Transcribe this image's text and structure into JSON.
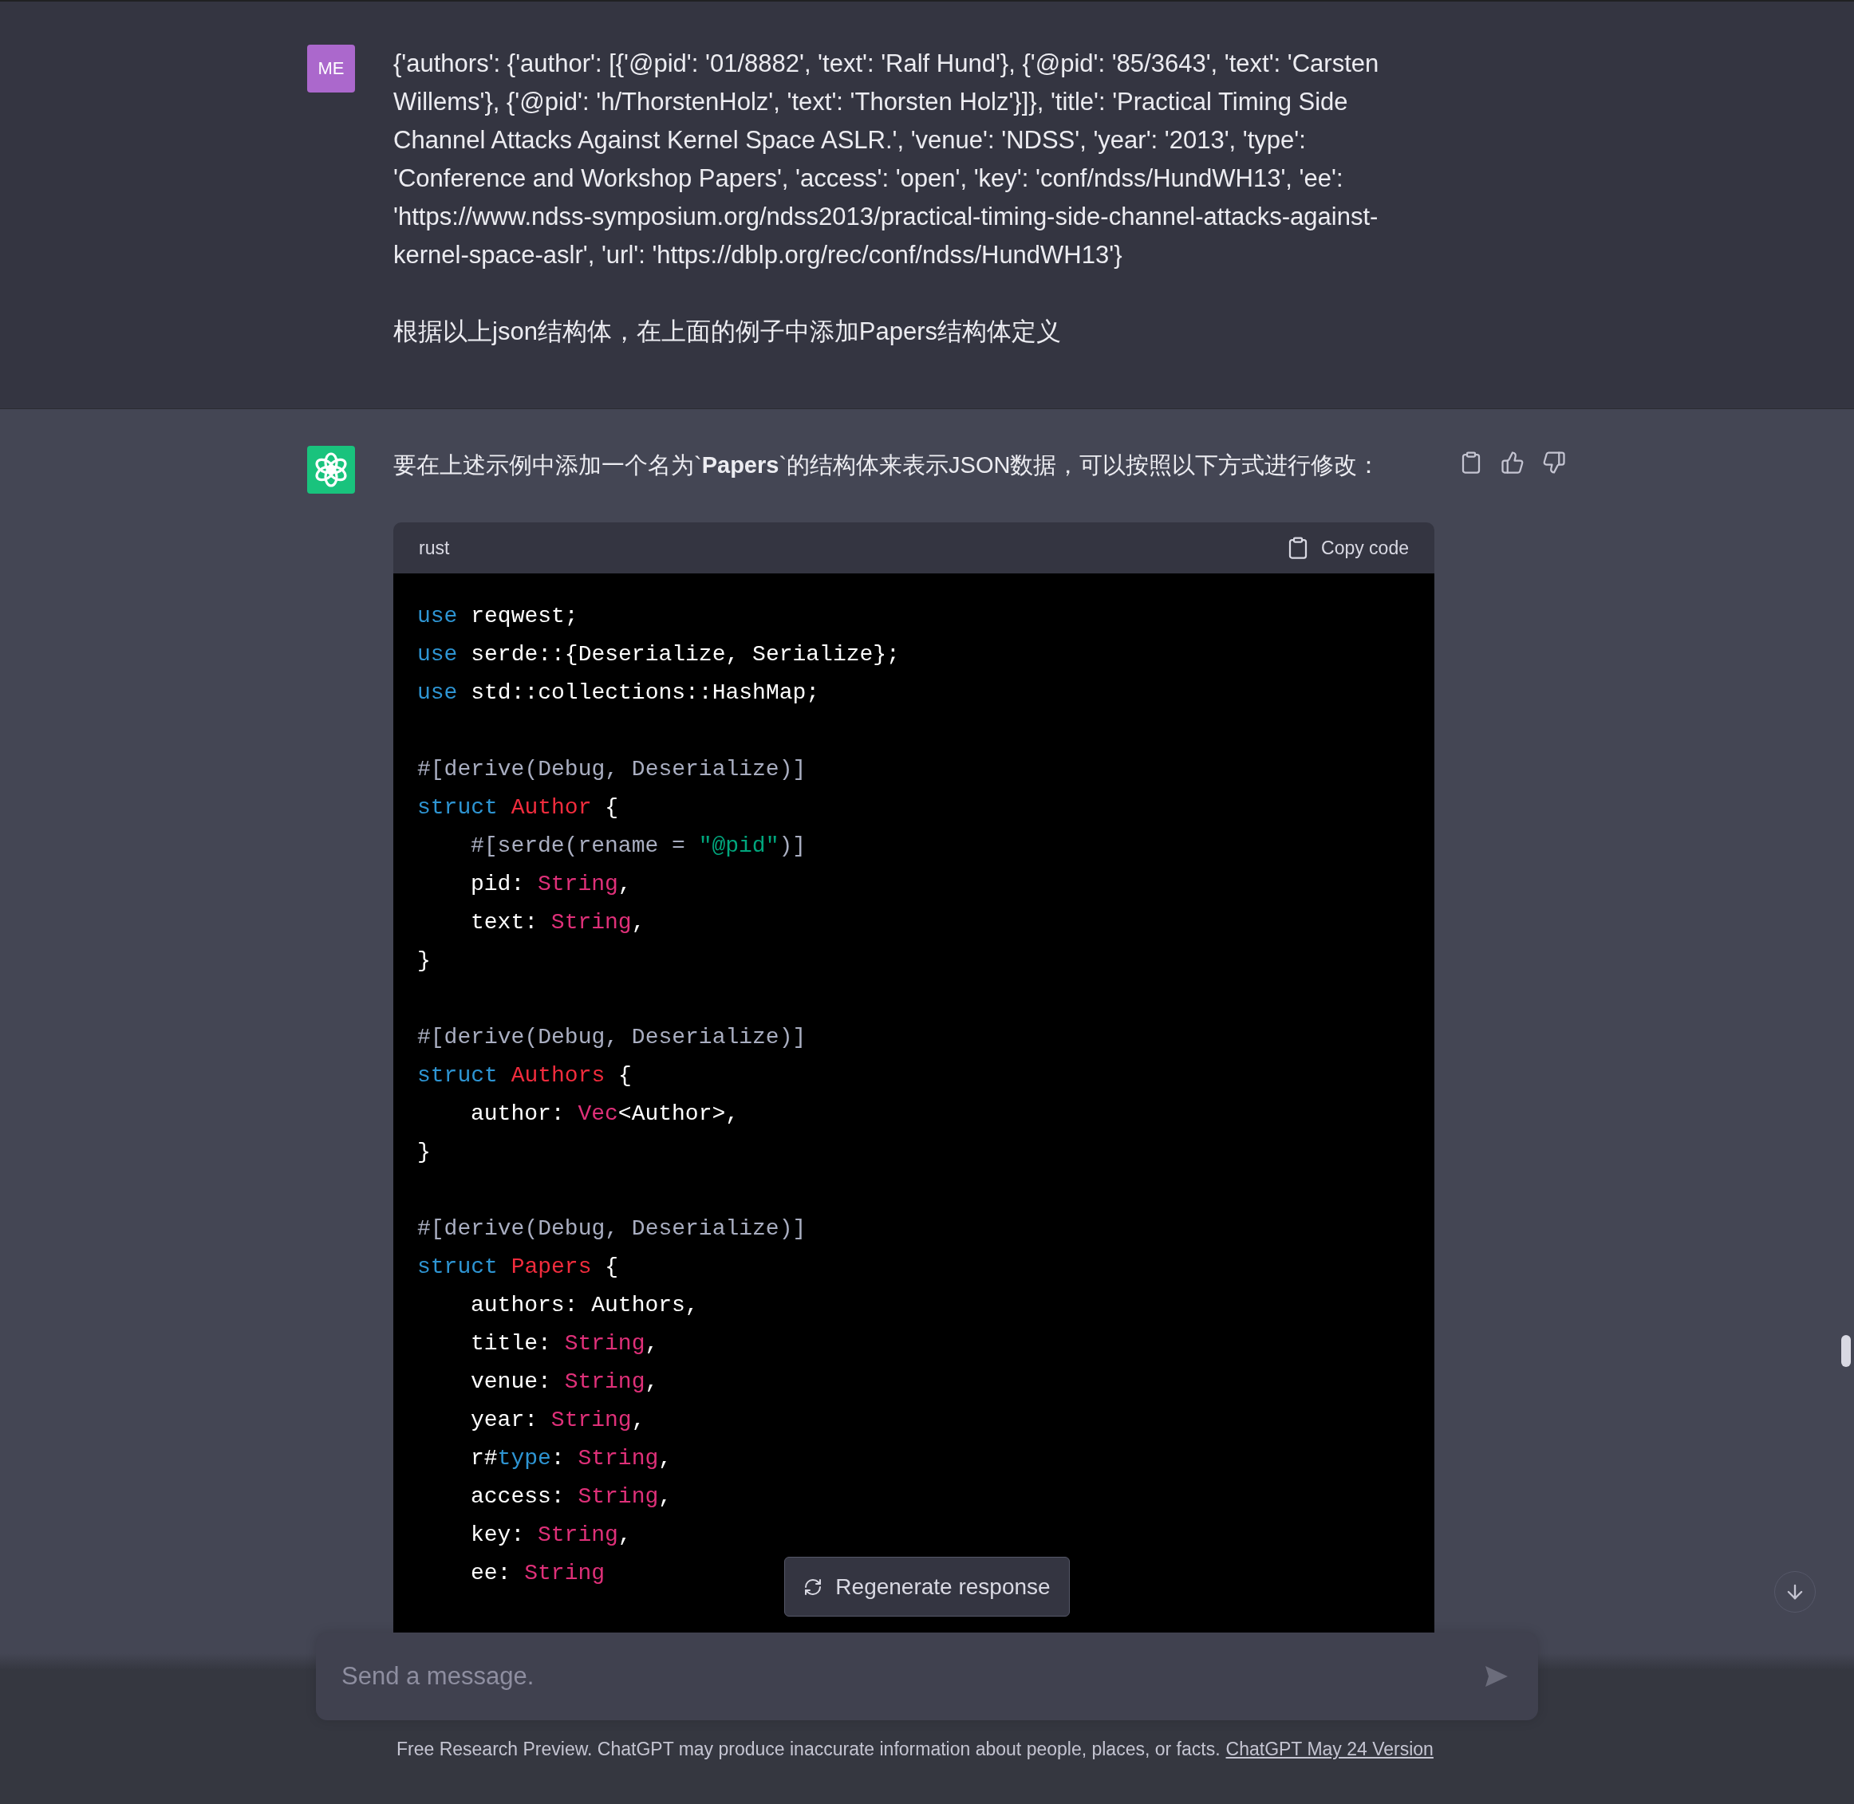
{
  "user_message": {
    "avatar": "ME",
    "paragraphs": [
      "{'authors': {'author': [{'@pid': '01/8882', 'text': 'Ralf Hund'}, {'@pid': '85/3643', 'text': 'Carsten Willems'}, {'@pid': 'h/ThorstenHolz', 'text': 'Thorsten Holz'}]}, 'title': 'Practical Timing Side Channel Attacks Against Kernel Space ASLR.', 'venue': 'NDSS', 'year': '2013', 'type': 'Conference and Workshop Papers', 'access': 'open', 'key': 'conf/ndss/HundWH13', 'ee': 'https://www.ndss-symposium.org/ndss2013/practical-timing-side-channel-attacks-against-kernel-space-aslr', 'url': 'https://dblp.org/rec/conf/ndss/HundWH13'}",
      "根据以上json结构体，在上面的例子中添加Papers结构体定义"
    ]
  },
  "assistant_message": {
    "paragraph": "要在上述示例中添加一个名为`**Papers**`的结构体来表示JSON数据，可以按照以下方式进行修改：",
    "code_block": {
      "language": "rust",
      "copy_label": "Copy code",
      "lines": [
        {
          "tokens": [
            {
              "kind": "kw",
              "text": "use"
            },
            {
              "kind": "plain",
              "text": " reqwest;"
            }
          ]
        },
        {
          "tokens": [
            {
              "kind": "kw",
              "text": "use"
            },
            {
              "kind": "plain",
              "text": " serde::{Deserialize, Serialize};"
            }
          ]
        },
        {
          "tokens": [
            {
              "kind": "kw",
              "text": "use"
            },
            {
              "kind": "plain",
              "text": " std::collections::HashMap;"
            }
          ]
        },
        {
          "kind": "blank"
        },
        {
          "tokens": [
            {
              "kind": "attr",
              "text": "#[derive(Debug, Deserialize)]"
            }
          ]
        },
        {
          "tokens": [
            {
              "kind": "kw",
              "text": "struct"
            },
            {
              "kind": "title",
              "text": " Author"
            },
            {
              "kind": "plain",
              "text": " {"
            }
          ]
        },
        {
          "indented": true,
          "tokens": [
            {
              "kind": "attr",
              "text": "#[serde(rename = "
            },
            {
              "kind": "str",
              "text": "\"@pid\""
            },
            {
              "kind": "attr",
              "text": ")]"
            }
          ]
        },
        {
          "indented": true,
          "tokens": [
            {
              "kind": "plain",
              "text": "pid: "
            },
            {
              "kind": "type",
              "text": "String"
            },
            {
              "kind": "plain",
              "text": ","
            }
          ]
        },
        {
          "indented": true,
          "tokens": [
            {
              "kind": "plain",
              "text": "text: "
            },
            {
              "kind": "type",
              "text": "String"
            },
            {
              "kind": "plain",
              "text": ","
            }
          ]
        },
        {
          "tokens": [
            {
              "kind": "plain",
              "text": "}"
            }
          ]
        },
        {
          "kind": "blank"
        },
        {
          "tokens": [
            {
              "kind": "attr",
              "text": "#[derive(Debug, Deserialize)]"
            }
          ]
        },
        {
          "tokens": [
            {
              "kind": "kw",
              "text": "struct"
            },
            {
              "kind": "title",
              "text": " Authors"
            },
            {
              "kind": "plain",
              "text": " {"
            }
          ]
        },
        {
          "indented": true,
          "tokens": [
            {
              "kind": "plain",
              "text": "author: "
            },
            {
              "kind": "type",
              "text": "Vec"
            },
            {
              "kind": "plain",
              "text": "<Author>,"
            }
          ]
        },
        {
          "tokens": [
            {
              "kind": "plain",
              "text": "}"
            }
          ]
        },
        {
          "kind": "blank"
        },
        {
          "tokens": [
            {
              "kind": "attr",
              "text": "#[derive(Debug, Deserialize)]"
            }
          ]
        },
        {
          "tokens": [
            {
              "kind": "kw",
              "text": "struct"
            },
            {
              "kind": "title",
              "text": " Papers"
            },
            {
              "kind": "plain",
              "text": " {"
            }
          ]
        },
        {
          "indented": true,
          "tokens": [
            {
              "kind": "plain",
              "text": "authors: Authors,"
            }
          ]
        },
        {
          "indented": true,
          "tokens": [
            {
              "kind": "plain",
              "text": "title: "
            },
            {
              "kind": "type",
              "text": "String"
            },
            {
              "kind": "plain",
              "text": ","
            }
          ]
        },
        {
          "indented": true,
          "tokens": [
            {
              "kind": "plain",
              "text": "venue: "
            },
            {
              "kind": "type",
              "text": "String"
            },
            {
              "kind": "plain",
              "text": ","
            }
          ]
        },
        {
          "indented": true,
          "tokens": [
            {
              "kind": "plain",
              "text": "year: "
            },
            {
              "kind": "type",
              "text": "String"
            },
            {
              "kind": "plain",
              "text": ","
            }
          ]
        },
        {
          "indented": true,
          "tokens": [
            {
              "kind": "plain",
              "text": "r#"
            },
            {
              "kind": "kw",
              "text": "type"
            },
            {
              "kind": "plain",
              "text": ": "
            },
            {
              "kind": "type",
              "text": "String"
            },
            {
              "kind": "plain",
              "text": ","
            }
          ]
        },
        {
          "indented": true,
          "tokens": [
            {
              "kind": "plain",
              "text": "access: "
            },
            {
              "kind": "type",
              "text": "String"
            },
            {
              "kind": "plain",
              "text": ","
            }
          ]
        },
        {
          "indented": true,
          "tokens": [
            {
              "kind": "plain",
              "text": "key: "
            },
            {
              "kind": "type",
              "text": "String"
            },
            {
              "kind": "plain",
              "text": ","
            }
          ]
        },
        {
          "indented": true,
          "tokens": [
            {
              "kind": "plain",
              "text": "ee: "
            },
            {
              "kind": "type",
              "text": "String"
            }
          ]
        }
      ]
    }
  },
  "regenerate_button": "Regenerate response",
  "composer": {
    "placeholder": "Send a message."
  },
  "footer": {
    "text": "Free Research Preview. ChatGPT may produce inaccurate information about people, places, or facts.",
    "link": "ChatGPT May 24 Version"
  }
}
